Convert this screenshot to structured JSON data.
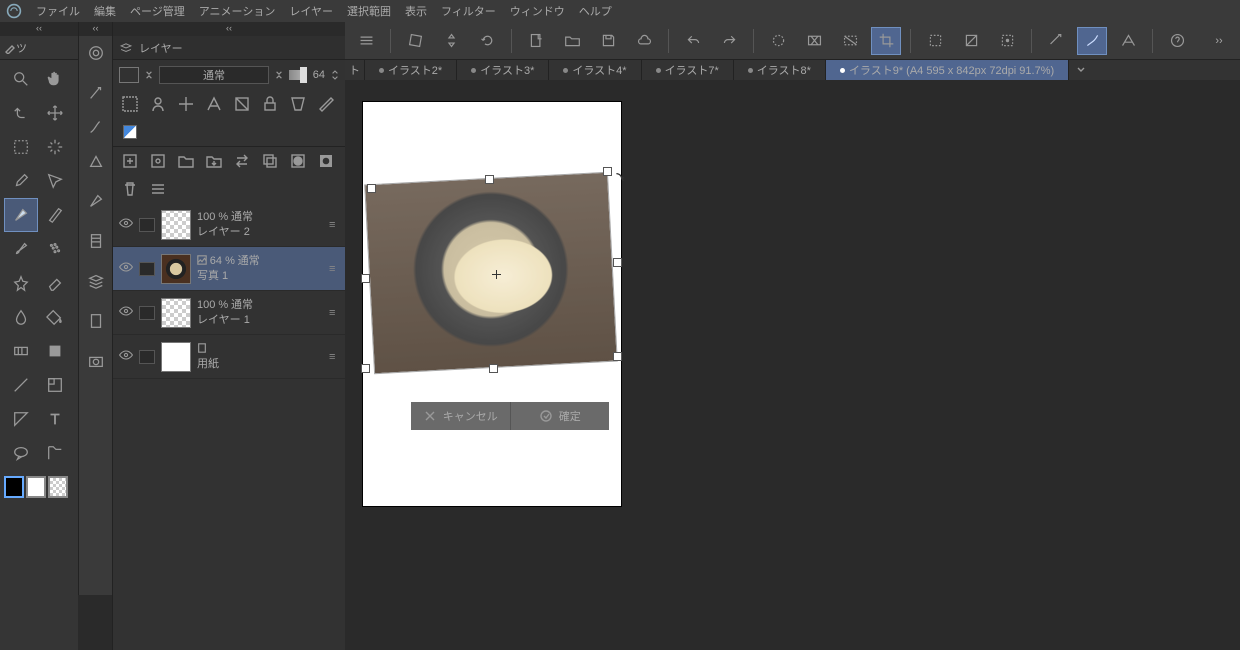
{
  "menu": [
    "ファイル",
    "編集",
    "ページ管理",
    "アニメーション",
    "レイヤー",
    "選択範囲",
    "表示",
    "フィルター",
    "ウィンドウ",
    "ヘルプ"
  ],
  "tool_title": "ツ",
  "opacity_value": "64",
  "layer_panel_title": "レイヤー",
  "blend_mode": "通常",
  "layers": [
    {
      "opacity": "100 %",
      "mode": "通常",
      "name": "レイヤー 2",
      "sel": false,
      "checker": true
    },
    {
      "opacity": "64 %",
      "mode": "通常",
      "name": "写真 1",
      "sel": true,
      "checker": false
    },
    {
      "opacity": "100 %",
      "mode": "通常",
      "name": "レイヤー 1",
      "sel": false,
      "checker": true
    },
    {
      "opacity": "",
      "mode": "",
      "name": "用紙",
      "sel": false,
      "checker": false
    }
  ],
  "tabs": [
    {
      "label": "ト",
      "edge": true
    },
    {
      "label": "イラスト2*"
    },
    {
      "label": "イラスト3*"
    },
    {
      "label": "イラスト4*"
    },
    {
      "label": "イラスト7*"
    },
    {
      "label": "イラスト8*"
    },
    {
      "label": "イラスト9* (A4 595 x 842px 72dpi 91.7%)",
      "active": true
    }
  ],
  "confirm": {
    "cancel": "キャンセル",
    "ok": "確定"
  }
}
